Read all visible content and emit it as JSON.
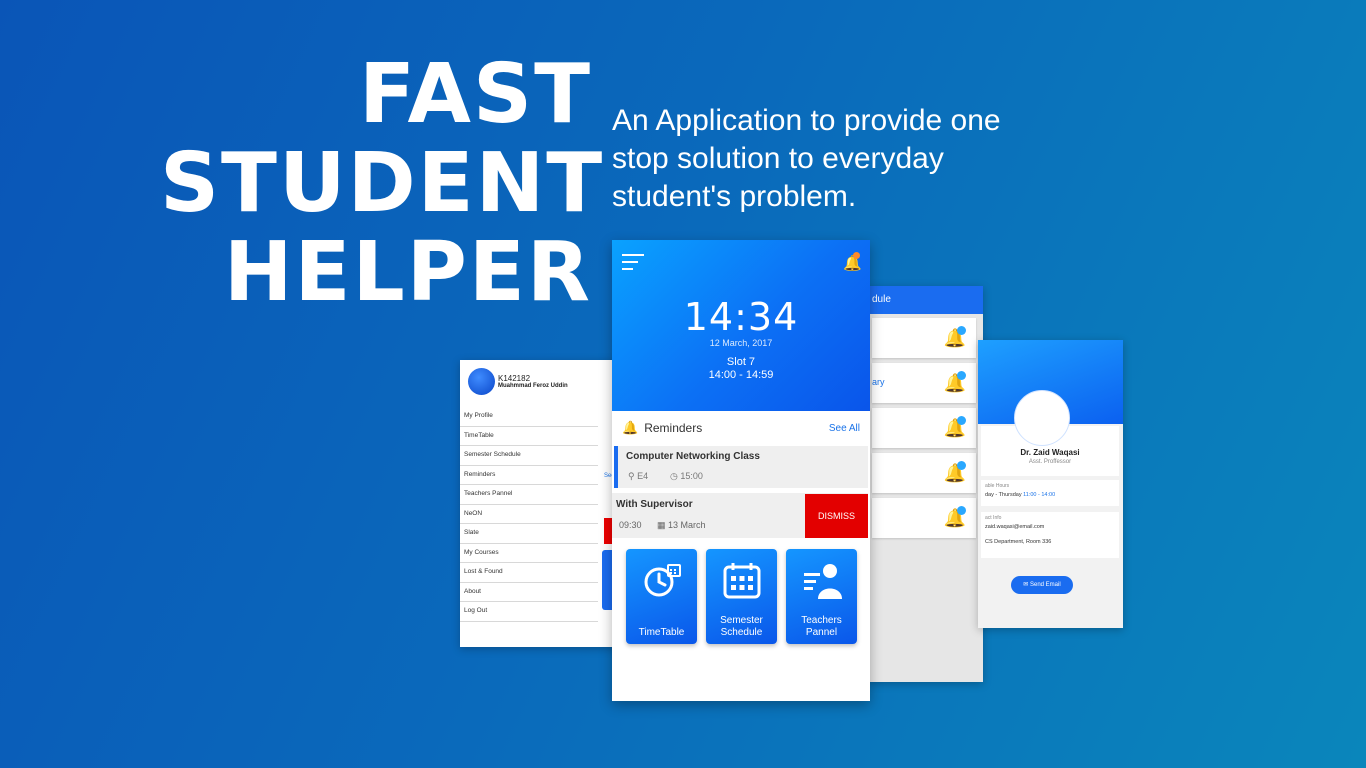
{
  "headline": {
    "line1": "FAST",
    "line2": "STUDENT",
    "line3": "HELPER"
  },
  "tagline": "An Application to provide one stop solution to everyday student's problem.",
  "menu": {
    "user_id": "K142182",
    "user_name": "Muahmmad Feroz Uddin",
    "items": [
      "My Profile",
      "TimeTable",
      "Semester Schedule",
      "Reminders",
      "Teachers Pannel",
      "NeON",
      "Slate",
      "My Courses",
      "Lost & Found",
      "About",
      "Log Out"
    ],
    "peek_see": "See A"
  },
  "main": {
    "time": "14:34",
    "date": "12 March, 2017",
    "slot": "Slot 7",
    "slot_range": "14:00 - 14:59",
    "reminders_title": "Reminders",
    "see_all": "See All",
    "reminder1": {
      "title": "Computer Networking Class",
      "room": "E4",
      "time": "15:00"
    },
    "reminder2": {
      "title": "With Supervisor",
      "time": "09:30",
      "date": "13 March"
    },
    "dismiss": "DISMISS",
    "tiles": [
      {
        "label": "TimeTable",
        "icon": "clock-calendar-icon"
      },
      {
        "label": "Semester Schedule",
        "icon": "calendar-icon"
      },
      {
        "label": "Teachers Pannel",
        "icon": "teacher-icon"
      }
    ]
  },
  "schedule": {
    "title": "dule",
    "peek_text": "ary"
  },
  "profile": {
    "name": "Dr. Zaid Waqasi",
    "title": "Asst. Proffessor",
    "hours_label": "able Hours",
    "hours_days": "day - Thursday ",
    "hours_time": "11:00 - 14:00",
    "contact_label": "act Info",
    "email": "zaid.waqasi@email.com",
    "office": "CS Department, Room 336",
    "send_email": "Send Email"
  },
  "colors": {
    "accent": "#1a6cf0",
    "dismiss": "#e30000",
    "background": "#0a69bb"
  }
}
